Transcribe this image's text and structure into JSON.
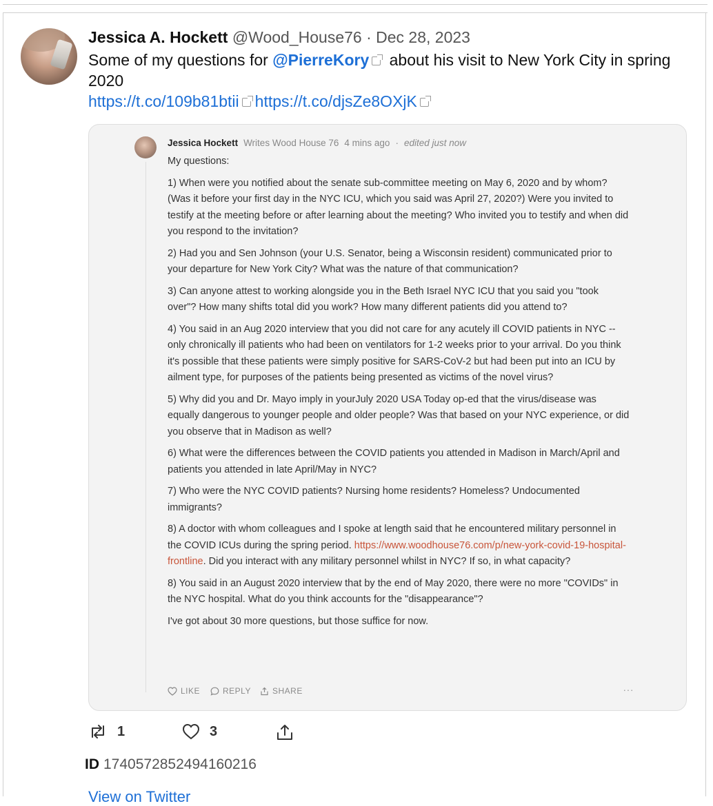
{
  "tweet": {
    "author_name": "Jessica A. Hockett",
    "handle": "@Wood_House76",
    "separator": "·",
    "date": "Dec 28, 2023",
    "text_prefix": "Some of my questions for ",
    "mention": "@PierreKory",
    "text_suffix": " about his visit to New York City in spring 2020",
    "link1": "https://t.co/109b81btii",
    "link2": "https://t.co/djsZe8OXjK",
    "retweet_count": "1",
    "like_count": "3",
    "id_label": "ID",
    "id_value": "1740572852494160216",
    "view_link": "View on Twitter"
  },
  "embedded_comment": {
    "author": "Jessica Hockett",
    "publication": "Writes Wood House 76",
    "time_ago": "4 mins ago",
    "separator": "·",
    "edited": "edited just now",
    "paragraphs": [
      "My questions:",
      "1) When were you notified about the senate sub-committee meeting on May 6, 2020 and by whom? (Was it before your first day in the NYC ICU, which you said was April 27, 2020?) Were you invited to testify at the meeting before or after learning about the meeting? Who invited you to testify and when did you respond to the invitation?",
      "2) Had you and Sen Johnson (your U.S. Senator, being a Wisconsin resident) communicated prior to your departure for New York City? What was the nature of that communication?",
      "3) Can anyone attest to working alongside you in the Beth Israel NYC ICU that you said you \"took over\"? How many shifts total did you work? How many different patients did you attend to?",
      "4) You said in an Aug 2020 interview that you did not care for any acutely ill COVID patients in NYC --only chronically ill patients who had been on ventilators for 1-2 weeks prior to your arrival. Do you think it's possible that these patients were simply positive for SARS-CoV-2 but had been put into an ICU by ailment type, for purposes of the patients being presented as victims of the novel virus?",
      "5) Why did you and Dr. Mayo imply in yourJuly 2020 USA Today op-ed that the virus/disease was equally dangerous to younger people and older people? Was that based on your NYC experience, or did you observe that in Madison as well?",
      "6) What were the differences between the COVID patients you attended in Madison in March/April and patients you attended in late April/May in NYC?",
      "7) Who were the NYC COVID patients? Nursing home residents? Homeless? Undocumented immigrants?"
    ],
    "p8_prefix": "8) A doctor with whom colleagues and I spoke at length said that he encountered military personnel in the COVID ICUs during the spring period. ",
    "p8_link": "https://www.woodhouse76.com/p/new-york-covid-19-hospital-frontline",
    "p8_suffix": ". Did you interact with any military personnel whilst in NYC? If so, in what capacity?",
    "p9": "8) You said in an August 2020 interview that by the end of May 2020, there were no more \"COVIDs\" in the NYC hospital. What do you think accounts for the \"disappearance\"?",
    "p10": "I've got about 30 more questions, but those suffice for now.",
    "actions": {
      "like": "LIKE",
      "reply": "REPLY",
      "share": "SHARE",
      "more": "···"
    }
  },
  "colors": {
    "link": "#1d6fd6",
    "comment_link": "#c8553a",
    "card_bg": "#f3f3f3"
  }
}
